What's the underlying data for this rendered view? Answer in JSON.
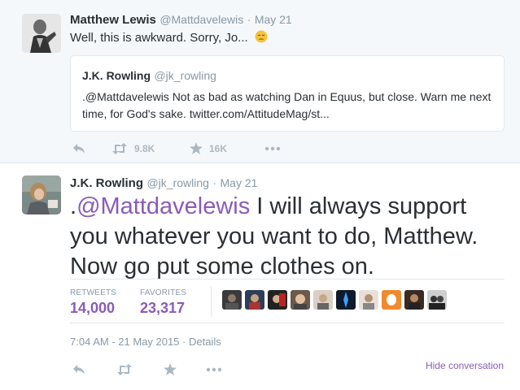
{
  "tweet1": {
    "name": "Matthew Lewis",
    "handle": "@Mattdavelewis",
    "dot": "·",
    "date": "May 21",
    "text": "Well, this is awkward. Sorry, Jo...",
    "emoji_icon": "pensive-face-emoji",
    "quote": {
      "name": "J.K. Rowling",
      "handle": "@jk_rowling",
      "text": ".@Mattdavelewis Not as bad as watching Dan in Equus, but close. Warn me next time, for God's sake. twitter.com/AttitudeMag/st..."
    },
    "actions": {
      "retweets": "9.8K",
      "favorites": "16K"
    }
  },
  "tweet2": {
    "name": "J.K. Rowling",
    "handle": "@jk_rowling",
    "dot": "·",
    "date": "May 21",
    "text_prefix": ".",
    "mention": "@Mattdavelewis",
    "text_body": " I will always support you whatever you want to do, Matthew.  Now go put some clothes on.",
    "stats": {
      "retweets_label": "RETWEETS",
      "retweets_value": "14,000",
      "favorites_label": "FAVORITES",
      "favorites_value": "23,317"
    },
    "timestamp": "7:04 AM - 21 May 2015 · Details",
    "hide_conversation": "Hide conversation"
  },
  "colors": {
    "accent": "#8a5bb8",
    "muted": "#8899a6",
    "icon": "#aab8c2",
    "text": "#292f33",
    "bg_context": "#f5f8fa"
  }
}
